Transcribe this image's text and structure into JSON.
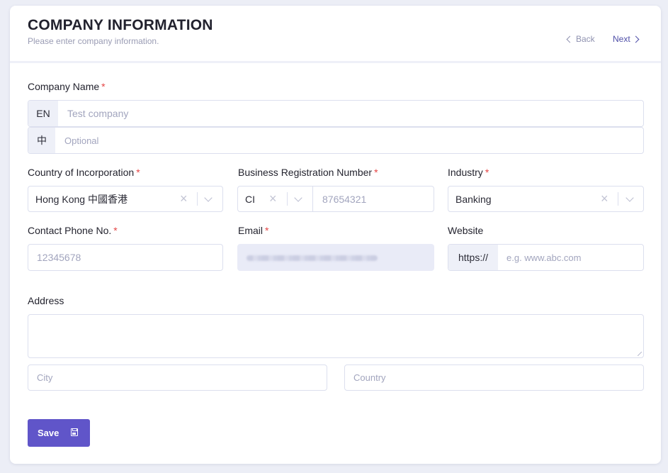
{
  "header": {
    "title": "COMPANY INFORMATION",
    "subtitle": "Please enter company information.",
    "back_label": "Back",
    "next_label": "Next"
  },
  "company_name": {
    "label": "Company Name",
    "required_mark": "*",
    "en_addon": "EN",
    "en_placeholder": "Test company",
    "zh_addon": "中",
    "zh_placeholder": "Optional"
  },
  "country": {
    "label": "Country of Incorporation",
    "required_mark": "*",
    "value": "Hong Kong 中國香港"
  },
  "brn": {
    "label": "Business Registration Number",
    "required_mark": "*",
    "prefix_value": "CI",
    "placeholder": "87654321"
  },
  "industry": {
    "label": "Industry",
    "required_mark": "*",
    "value": "Banking"
  },
  "phone": {
    "label": "Contact Phone No.",
    "required_mark": "*",
    "placeholder": "12345678"
  },
  "email": {
    "label": "Email",
    "required_mark": "*"
  },
  "website": {
    "label": "Website",
    "addon": "https://",
    "placeholder": "e.g. www.abc.com"
  },
  "address": {
    "label": "Address",
    "city_placeholder": "City",
    "country_placeholder": "Country"
  },
  "actions": {
    "save_label": "Save"
  },
  "icons": {
    "clear": "close-icon",
    "dropdown": "chevron-down-icon",
    "back": "chevron-left-icon",
    "next": "chevron-right-icon",
    "save": "floppy-disk-icon"
  },
  "colors": {
    "accent": "#6055c9",
    "required": "#e54545",
    "background": "#eceef6"
  }
}
